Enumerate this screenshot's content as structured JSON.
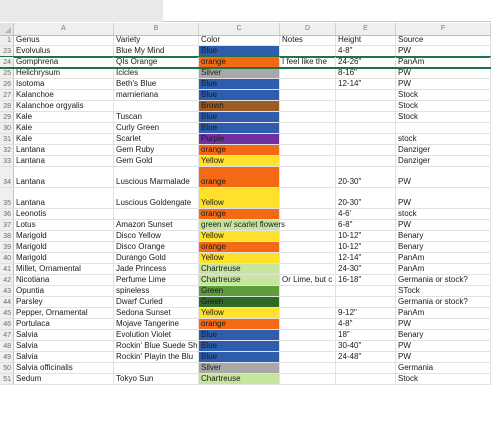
{
  "columns": [
    {
      "letter": "",
      "width": 14
    },
    {
      "letter": "A",
      "width": 100
    },
    {
      "letter": "B",
      "width": 85
    },
    {
      "letter": "C",
      "width": 81
    },
    {
      "letter": "D",
      "width": 56
    },
    {
      "letter": "E",
      "width": 60
    },
    {
      "letter": "F",
      "width": 95
    }
  ],
  "rows": [
    {
      "num": "1",
      "h": 10,
      "cells": [
        "Genus",
        "Variety",
        "Color",
        "Notes",
        "Height",
        "Source"
      ],
      "fill": "",
      "header": true
    },
    {
      "num": "23",
      "h": 11,
      "cells": [
        "Evolvulus",
        "Blue My Mind",
        "Blue",
        "",
        "4-8\"",
        "PW"
      ],
      "fill": "#2e5dae"
    },
    {
      "num": "24",
      "h": 11,
      "cells": [
        "Gomphrena",
        "QIs Orange",
        "orange",
        "I feel like the",
        "24-26\"",
        "PanAm"
      ],
      "fill": "#f46a14",
      "selected": true
    },
    {
      "num": "25",
      "h": 11,
      "cells": [
        "Helichrysum",
        "Icicles",
        "Silver",
        "",
        "8-16\"",
        "PW"
      ],
      "fill": "#a8a8a8"
    },
    {
      "num": "26",
      "h": 11,
      "cells": [
        "Isotoma",
        "Beth's Blue",
        "Blue",
        "",
        "12-14\"",
        "PW"
      ],
      "fill": "#2e5dae"
    },
    {
      "num": "27",
      "h": 11,
      "cells": [
        "Kalanchoe",
        "marnieriana",
        "Blue",
        "",
        "",
        "Stock"
      ],
      "fill": "#2e5dae"
    },
    {
      "num": "28",
      "h": 11,
      "cells": [
        "Kalanchoe orgyalis",
        "",
        "Brown",
        "",
        "",
        "Stock"
      ],
      "fill": "#9b5b24"
    },
    {
      "num": "29",
      "h": 11,
      "cells": [
        "Kale",
        "Tuscan",
        "Blue",
        "",
        "",
        "Stock"
      ],
      "fill": "#2e5dae"
    },
    {
      "num": "30",
      "h": 11,
      "cells": [
        "Kale",
        "Curly Green",
        "Blue",
        "",
        "",
        ""
      ],
      "fill": "#2e5dae"
    },
    {
      "num": "31",
      "h": 11,
      "cells": [
        "Kale",
        "Scarlet",
        "Purple",
        "",
        "",
        "stock"
      ],
      "fill": "#7030a0"
    },
    {
      "num": "32",
      "h": 11,
      "cells": [
        "Lantana",
        "Gem Ruby",
        "orange",
        "",
        "",
        "Danziger"
      ],
      "fill": "#f46a14"
    },
    {
      "num": "33",
      "h": 11,
      "cells": [
        "Lantana",
        "Gem Gold",
        "Yellow",
        "",
        "",
        "Danziger"
      ],
      "fill": "#ffe12c"
    },
    {
      "num": "34",
      "h": 21,
      "cells": [
        "Lantana",
        "Luscious Marmalade",
        "orange",
        "",
        "20-30\"",
        "PW"
      ],
      "fill": "#f46a14"
    },
    {
      "num": "35",
      "h": 21,
      "cells": [
        "Lantana",
        "Luscious Goldengate",
        "Yellow",
        "",
        "20-30\"",
        "PW"
      ],
      "fill": "#ffe12c"
    },
    {
      "num": "36",
      "h": 11,
      "cells": [
        "Leonotis",
        "",
        "orange",
        "",
        "4-6'",
        "stock"
      ],
      "fill": "#f46a14"
    },
    {
      "num": "37",
      "h": 11,
      "cells": [
        "Lotus",
        "Amazon Sunset",
        "green w/ scarlet flowers",
        "",
        "6-8\"",
        "PW"
      ],
      "fill": "#c6e69f"
    },
    {
      "num": "38",
      "h": 11,
      "cells": [
        "Marigold",
        "Disco Yellow",
        "Yellow",
        "",
        "10-12\"",
        "Benary"
      ],
      "fill": "#ffe12c"
    },
    {
      "num": "39",
      "h": 11,
      "cells": [
        "Marigold",
        "Disco Orange",
        "orange",
        "",
        "10-12\"",
        "Benary"
      ],
      "fill": "#f46a14"
    },
    {
      "num": "40",
      "h": 11,
      "cells": [
        "Marigold",
        "Durango Gold",
        "Yellow",
        "",
        "12-14\"",
        "PanAm"
      ],
      "fill": "#ffe12c"
    },
    {
      "num": "41",
      "h": 11,
      "cells": [
        "Millet, Ornamental",
        "Jade Princess",
        "Chartreuse",
        "",
        "24-30\"",
        "PanAm"
      ],
      "fill": "#c6e69f"
    },
    {
      "num": "42",
      "h": 11,
      "cells": [
        "Nicotiana",
        "Perfume Lime",
        "Chartreuse",
        "Or Lime, but c",
        "16-18\"",
        "Germania or stock?"
      ],
      "fill": "#c6e69f"
    },
    {
      "num": "43",
      "h": 11,
      "cells": [
        "Opuntia",
        "spineless",
        "Green",
        "",
        "",
        "STock"
      ],
      "fill": "#5d9e3a"
    },
    {
      "num": "44",
      "h": 11,
      "cells": [
        "Parsley",
        "Dwarf Curled",
        "Green",
        "",
        "",
        "Germania or stock?"
      ],
      "fill": "#2f6b26"
    },
    {
      "num": "45",
      "h": 11,
      "cells": [
        "Pepper, Ornamental",
        "Sedona Sunset",
        "Yellow",
        "",
        "9-12\"",
        "PanAm"
      ],
      "fill": "#ffe12c"
    },
    {
      "num": "46",
      "h": 11,
      "cells": [
        "Portulaca",
        "Mojave Tangerine",
        "orange",
        "",
        "4-8\"",
        "PW"
      ],
      "fill": "#f46a14"
    },
    {
      "num": "47",
      "h": 11,
      "cells": [
        "Salvia",
        "Evolution Violet",
        "Blue",
        "",
        "18\"",
        "Benary"
      ],
      "fill": "#2e5dae"
    },
    {
      "num": "48",
      "h": 11,
      "cells": [
        "Salvia",
        "Rockin' Blue Suede Sh",
        "Blue",
        "",
        "30-40\"",
        "PW"
      ],
      "fill": "#2e5dae"
    },
    {
      "num": "49",
      "h": 11,
      "cells": [
        "Salvia",
        "Rockin' Playin the Blu",
        "Blue",
        "",
        "24-48\"",
        "PW"
      ],
      "fill": "#2e5dae"
    },
    {
      "num": "50",
      "h": 11,
      "cells": [
        "Salvia officinalis",
        "",
        "Silver",
        "",
        "",
        "Germania"
      ],
      "fill": "#a8a8a8"
    },
    {
      "num": "51",
      "h": 11,
      "cells": [
        "Sedum",
        "Tokyo Sun",
        "Chartreuse",
        "",
        "",
        "Stock"
      ],
      "fill": "#c6e69f"
    }
  ]
}
